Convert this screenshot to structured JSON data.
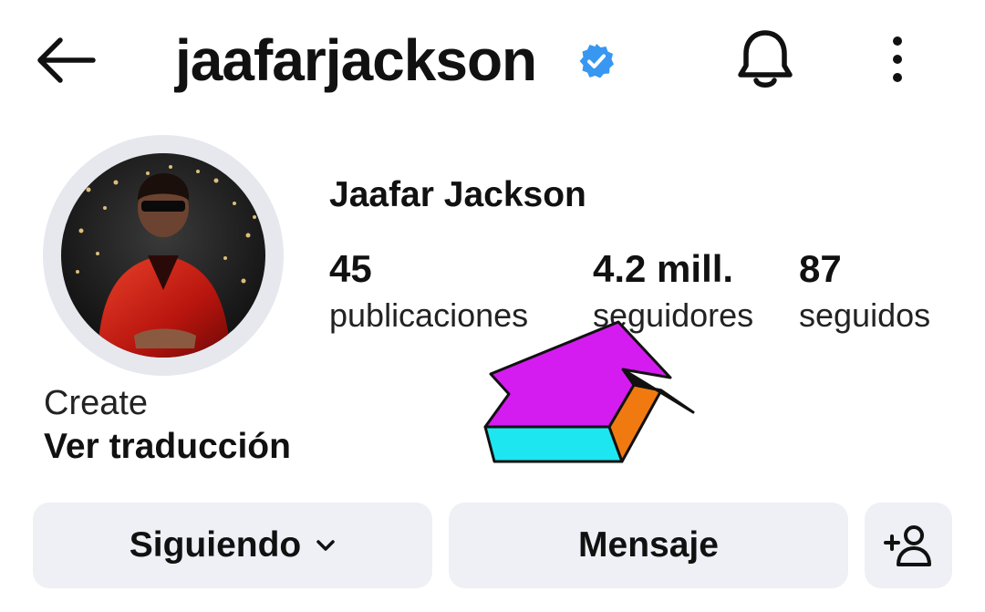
{
  "header": {
    "username": "jaafarjackson",
    "icons": {
      "back": "arrow-left-icon",
      "verified": "verified-badge-icon",
      "notifications": "bell-icon",
      "more": "more-vertical-icon"
    }
  },
  "profile": {
    "display_name": "Jaafar Jackson",
    "avatar": "profile-photo-avatar",
    "stats": [
      {
        "count": "45",
        "label": "publicaciones"
      },
      {
        "count": "4.2 mill.",
        "label": "seguidores"
      },
      {
        "count": "87",
        "label": "seguidos"
      }
    ],
    "bio": "Create",
    "translate_label": "Ver traducción"
  },
  "actions": {
    "following_label": "Siguiendo",
    "message_label": "Mensaje",
    "add_person_icon": "add-person-icon"
  },
  "colors": {
    "verified_blue": "#3897f0",
    "button_bg": "#eef0f5",
    "avatar_ring": "#e6e8ee",
    "arrow_top": "#d51cf0",
    "arrow_front": "#1ee6f0",
    "arrow_side": "#f07a10"
  }
}
